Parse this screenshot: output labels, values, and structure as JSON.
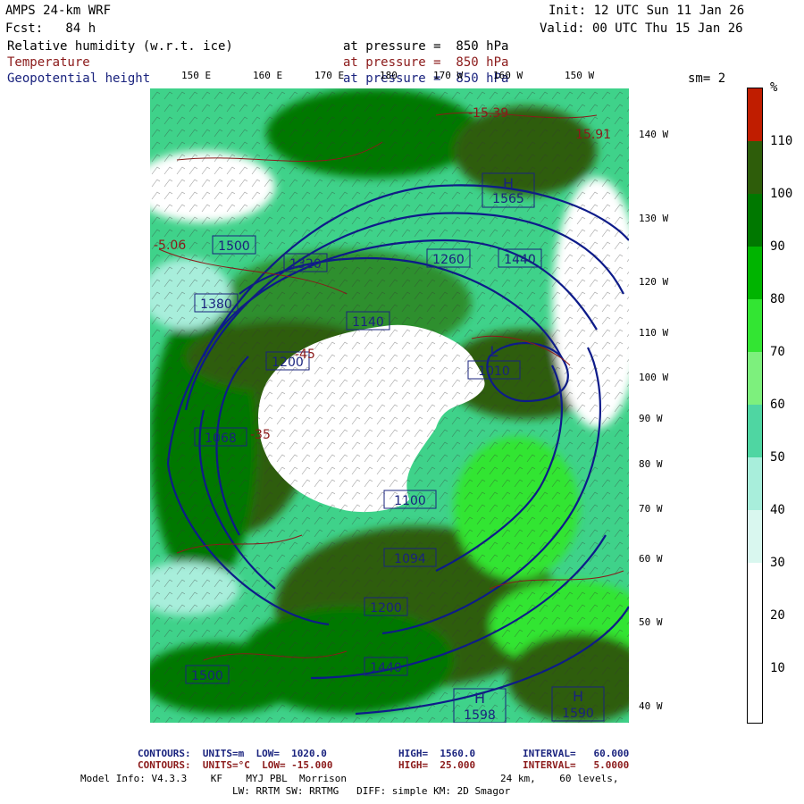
{
  "header": {
    "model": "AMPS 24-km WRF",
    "fcst": "Fcst:   84 h",
    "init": "Init: 12 UTC Sun 11 Jan 26",
    "valid": "Valid: 00 UTC Thu 15 Jan 26",
    "fields": [
      {
        "name": "Relative humidity (w.r.t. ice)",
        "level": "at pressure =  850 hPa",
        "color": "#000000"
      },
      {
        "name": "Temperature",
        "level": "at pressure =  850 hPa",
        "color": "#8b1a1a"
      },
      {
        "name": "Geopotential height",
        "level": "at pressure =  850 hPa",
        "color": "#1a237e"
      }
    ],
    "smoothing": "sm= 2"
  },
  "map": {
    "longitude_labels": [
      "150 E",
      "160 E",
      "170 E",
      "180",
      "170 W",
      "160 W",
      "150 W"
    ],
    "latitude_labels": [
      "140 W",
      "130 W",
      "120 W",
      "110 W",
      "100 W",
      "90 W",
      "80 W",
      "70 W",
      "60 W",
      "50 W",
      "40 W"
    ],
    "height_labels": [
      "1500",
      "1320",
      "1260",
      "1380",
      "1440",
      "1200",
      "1140",
      "1068",
      "1010",
      "1094",
      "1100",
      "1565",
      "1598",
      "1590",
      "1200",
      "1440",
      "1500"
    ],
    "pressure_centers": [
      "H",
      "L",
      "H",
      "H"
    ],
    "temperature_labels": [
      "-45",
      "-35",
      "-15.39",
      "-5.06",
      "15.91"
    ]
  },
  "colorbar": {
    "unit": "%",
    "labels": [
      "110",
      "100",
      "90",
      "80",
      "70",
      "60",
      "50",
      "40",
      "30",
      "20",
      "10"
    ],
    "colors": [
      "#ffffff",
      "#ffffff",
      "#d9f7ef",
      "#a8eedb",
      "#4fd6a2",
      "#7df07d",
      "#33e533",
      "#00b400",
      "#007800",
      "#2e5d0a",
      "#c01d00"
    ]
  },
  "footer": {
    "line1_prefix": "CONTOURS:  UNITS=m  LOW=  1020.0",
    "line1_high": "HIGH=  1560.0",
    "line1_interval": "INTERVAL=   60.000",
    "line2_prefix": "CONTOURS:  UNITS=°C  LOW= -15.000",
    "line2_high": "HIGH=  25.000",
    "line2_interval": "INTERVAL=   5.0000",
    "model_info": "Model Info: V4.3.3    KF    MYJ PBL  Morrison",
    "grid_info": "24 km,    60 levels,",
    "physics": "LW: RRTM SW: RRTMG   DIFF: simple KM: 2D Smagor"
  }
}
